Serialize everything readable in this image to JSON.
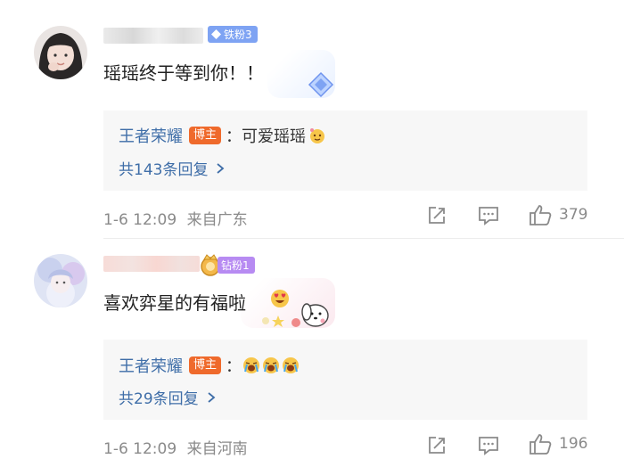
{
  "comments": [
    {
      "badge": "铁粉3",
      "text": "瑶瑶终于等到你！！",
      "reply": {
        "author": "王者荣耀",
        "tag": "博主",
        "sep": "：",
        "text": "可爱瑶瑶"
      },
      "more": "共143条回复",
      "time": "1-6 12:09",
      "location": "来自广东",
      "likes": "379"
    },
    {
      "badge": "钻粉1",
      "text": "喜欢弈星的有福啦",
      "reply": {
        "author": "王者荣耀",
        "tag": "博主",
        "sep": "："
      },
      "more": "共29条回复",
      "time": "1-6 12:09",
      "location": "来自河南",
      "likes": "196"
    }
  ],
  "colors": {
    "author_blue": "#3f6ea8",
    "host_tag": "#ef6a2c",
    "badge_iron": "#7ea3f3",
    "badge_diamond": "#b78bf2"
  },
  "icons": [
    "share-icon",
    "comment-icon",
    "thumbs-up-icon",
    "chevron-right-icon",
    "gem-icon"
  ]
}
